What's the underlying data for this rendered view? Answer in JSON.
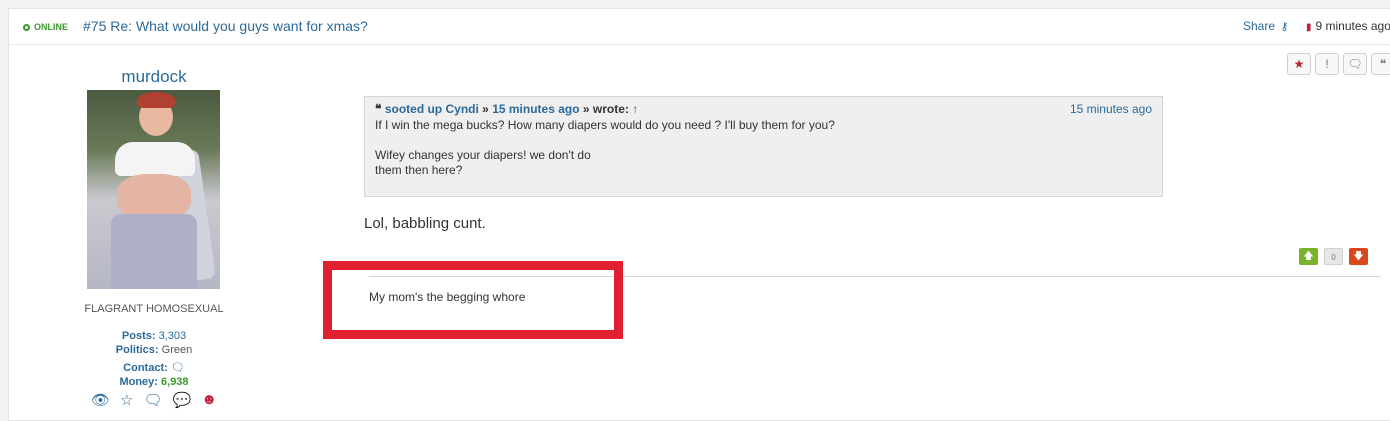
{
  "header": {
    "status": "ONLINE",
    "title": "#75 Re: What would you guys want for xmas?",
    "share_label": "Share",
    "time": "9 minutes ago"
  },
  "user": {
    "name": "murdock",
    "rank": "FLAGRANT HOMOSEXUAL",
    "posts_label": "Posts:",
    "posts_value": "3,303",
    "politics_label": "Politics:",
    "politics_value": "Green",
    "contact_label": "Contact:",
    "money_label": "Money:",
    "money_value": "6,938"
  },
  "quote": {
    "author": "sooted up Cyndi",
    "sep1": "»",
    "ago": "15 minutes ago",
    "sep2": "» wrote:",
    "arrow": "↑",
    "time": "15 minutes ago",
    "line1": "If I win the mega bucks?  How many diapers would do you need ? I'll buy them for you?",
    "line2": "Wifey changes your diapers! we don't do",
    "line3": "them then here?"
  },
  "message": "Lol, babbling cunt.",
  "votes": {
    "count": "0"
  },
  "signature": "My mom's the begging whore",
  "colors": {
    "link": "#2b6a9a",
    "online": "#3a9a2a",
    "highlight": "#e02030"
  },
  "icons": [
    "online-dot-icon",
    "share-icon",
    "document-icon",
    "star-icon",
    "exclamation-icon",
    "chat-icon",
    "quote-icon",
    "eye-icon",
    "star-outline-icon",
    "comments-icon",
    "chat-bubbles-icon",
    "user-circle-icon",
    "thumb-up-icon",
    "thumb-down-icon"
  ]
}
